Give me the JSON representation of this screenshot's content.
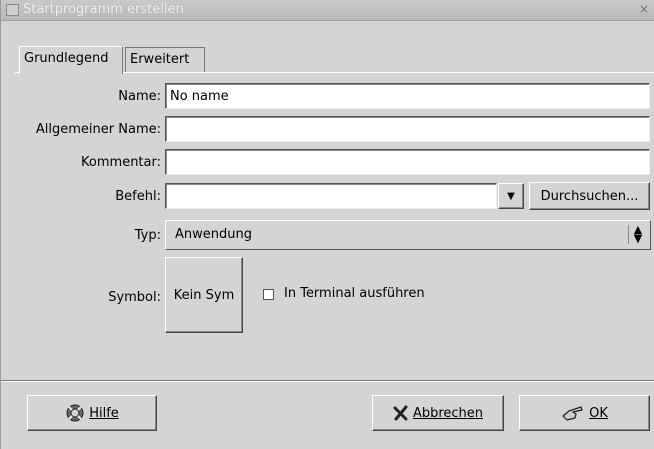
{
  "window": {
    "title": "Startprogramm erstellen",
    "close_glyph": "×"
  },
  "tabs": [
    {
      "label": "Grundlegend",
      "active": true
    },
    {
      "label": "Erweitert",
      "active": false
    }
  ],
  "form": {
    "name_label": "Name:",
    "name_value": "No name",
    "generic_name_label": "Allgemeiner Name:",
    "generic_name_value": "",
    "comment_label": "Kommentar:",
    "comment_value": "",
    "command_label": "Befehl:",
    "command_value": "",
    "browse_label": "Durchsuchen...",
    "type_label": "Typ:",
    "type_value": "Anwendung",
    "icon_label": "Symbol:",
    "icon_button": "Kein Sym",
    "terminal_label": "In Terminal ausführen",
    "terminal_checked": false
  },
  "actions": {
    "help": "Hilfe",
    "cancel": "Abbrechen",
    "ok": "OK"
  },
  "icons": {
    "help": "lifebuoy-icon",
    "cancel": "cross-icon",
    "ok": "pointing-hand-icon",
    "combo": "triangle-down-icon",
    "select": "updown-arrows-icon"
  }
}
